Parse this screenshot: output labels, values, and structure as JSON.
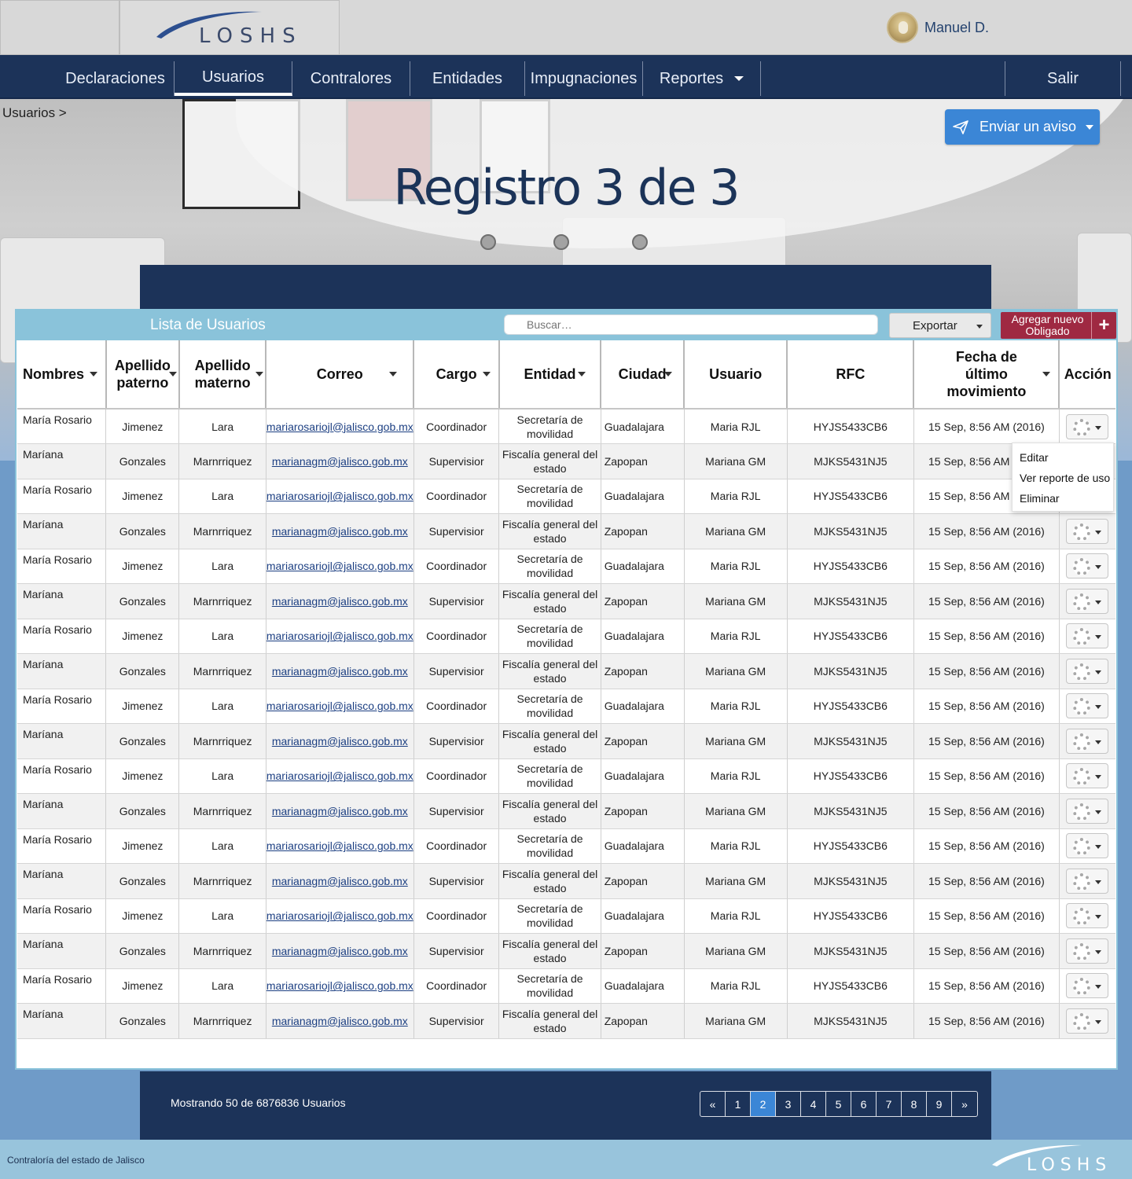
{
  "header": {
    "logo_text": "LOSHS",
    "user_name": "Manuel D."
  },
  "nav": {
    "items": [
      {
        "label": "Declaraciones"
      },
      {
        "label": "Usuarios"
      },
      {
        "label": "Contralores"
      },
      {
        "label": "Entidades"
      },
      {
        "label": "Impugnaciones"
      },
      {
        "label": "Reportes"
      }
    ],
    "active": "Usuarios",
    "logout": "Salir"
  },
  "hero": {
    "breadcrumb": "Usuarios >",
    "send_notice": "Enviar un aviso",
    "title": "Registro 3 de 3"
  },
  "panel": {
    "title": "Lista de Usuarios",
    "search_placeholder": "Buscar…",
    "export": "Exportar",
    "add_new": "Agregar nuevo Obligado",
    "add_icon": "+"
  },
  "table": {
    "headers": {
      "nombres": "Nombres",
      "ap_paterno": "Apellido paterno",
      "ap_materno": "Apellido materno",
      "correo": "Correo",
      "cargo": "Cargo",
      "entidad": "Entidad",
      "ciudad": "Ciudad",
      "usuario": "Usuario",
      "rfc": "RFC",
      "fecha": "Fecha de último movimiento",
      "accion": "Acción"
    },
    "rows": [
      {
        "nombres": "María Rosario",
        "paterno": "Jimenez",
        "materno": "Lara",
        "correo": "mariarosariojl@jalisco.gob.mx",
        "cargo": "Coordinador",
        "entidad": "Secretaría de movilidad",
        "ciudad": "Guadalajara",
        "usuario": "Maria RJL",
        "rfc": "HYJS5433CB6",
        "fecha": "15 Sep, 8:56 AM (2016)"
      },
      {
        "nombres": "Maríana",
        "paterno": "Gonzales",
        "materno": "Marnrriquez",
        "correo": "marianagm@jalisco.gob.mx",
        "cargo": "Supervisior",
        "entidad": "Fiscalía general del estado",
        "ciudad": "Zapopan",
        "usuario": "Mariana GM",
        "rfc": "MJKS5431NJ5",
        "fecha": "15 Sep, 8:56 AM (2016)"
      },
      {
        "nombres": "María Rosario",
        "paterno": "Jimenez",
        "materno": "Lara",
        "correo": "mariarosariojl@jalisco.gob.mx",
        "cargo": "Coordinador",
        "entidad": "Secretaría de movilidad",
        "ciudad": "Guadalajara",
        "usuario": "Maria RJL",
        "rfc": "HYJS5433CB6",
        "fecha": "15 Sep, 8:56 AM (2016)"
      },
      {
        "nombres": "Maríana",
        "paterno": "Gonzales",
        "materno": "Marnrriquez",
        "correo": "marianagm@jalisco.gob.mx",
        "cargo": "Supervisior",
        "entidad": "Fiscalía general del estado",
        "ciudad": "Zapopan",
        "usuario": "Mariana GM",
        "rfc": "MJKS5431NJ5",
        "fecha": "15 Sep, 8:56 AM (2016)"
      },
      {
        "nombres": "María Rosario",
        "paterno": "Jimenez",
        "materno": "Lara",
        "correo": "mariarosariojl@jalisco.gob.mx",
        "cargo": "Coordinador",
        "entidad": "Secretaría de movilidad",
        "ciudad": "Guadalajara",
        "usuario": "Maria RJL",
        "rfc": "HYJS5433CB6",
        "fecha": "15 Sep, 8:56 AM (2016)"
      },
      {
        "nombres": "Maríana",
        "paterno": "Gonzales",
        "materno": "Marnrriquez",
        "correo": "marianagm@jalisco.gob.mx",
        "cargo": "Supervisior",
        "entidad": "Fiscalía general del estado",
        "ciudad": "Zapopan",
        "usuario": "Mariana GM",
        "rfc": "MJKS5431NJ5",
        "fecha": "15 Sep, 8:56 AM (2016)"
      },
      {
        "nombres": "María Rosario",
        "paterno": "Jimenez",
        "materno": "Lara",
        "correo": "mariarosariojl@jalisco.gob.mx",
        "cargo": "Coordinador",
        "entidad": "Secretaría de movilidad",
        "ciudad": "Guadalajara",
        "usuario": "Maria RJL",
        "rfc": "HYJS5433CB6",
        "fecha": "15 Sep, 8:56 AM (2016)"
      },
      {
        "nombres": "Maríana",
        "paterno": "Gonzales",
        "materno": "Marnrriquez",
        "correo": "marianagm@jalisco.gob.mx",
        "cargo": "Supervisior",
        "entidad": "Fiscalía general del estado",
        "ciudad": "Zapopan",
        "usuario": "Mariana GM",
        "rfc": "MJKS5431NJ5",
        "fecha": "15 Sep, 8:56 AM (2016)"
      },
      {
        "nombres": "María Rosario",
        "paterno": "Jimenez",
        "materno": "Lara",
        "correo": "mariarosariojl@jalisco.gob.mx",
        "cargo": "Coordinador",
        "entidad": "Secretaría de movilidad",
        "ciudad": "Guadalajara",
        "usuario": "Maria RJL",
        "rfc": "HYJS5433CB6",
        "fecha": "15 Sep, 8:56 AM (2016)"
      },
      {
        "nombres": "Maríana",
        "paterno": "Gonzales",
        "materno": "Marnrriquez",
        "correo": "marianagm@jalisco.gob.mx",
        "cargo": "Supervisior",
        "entidad": "Fiscalía general del estado",
        "ciudad": "Zapopan",
        "usuario": "Mariana GM",
        "rfc": "MJKS5431NJ5",
        "fecha": "15 Sep, 8:56 AM (2016)"
      },
      {
        "nombres": "María Rosario",
        "paterno": "Jimenez",
        "materno": "Lara",
        "correo": "mariarosariojl@jalisco.gob.mx",
        "cargo": "Coordinador",
        "entidad": "Secretaría de movilidad",
        "ciudad": "Guadalajara",
        "usuario": "Maria RJL",
        "rfc": "HYJS5433CB6",
        "fecha": "15 Sep, 8:56 AM (2016)"
      },
      {
        "nombres": "Maríana",
        "paterno": "Gonzales",
        "materno": "Marnrriquez",
        "correo": "marianagm@jalisco.gob.mx",
        "cargo": "Supervisior",
        "entidad": "Fiscalía general del estado",
        "ciudad": "Zapopan",
        "usuario": "Mariana GM",
        "rfc": "MJKS5431NJ5",
        "fecha": "15 Sep, 8:56 AM (2016)"
      },
      {
        "nombres": "María Rosario",
        "paterno": "Jimenez",
        "materno": "Lara",
        "correo": "mariarosariojl@jalisco.gob.mx",
        "cargo": "Coordinador",
        "entidad": "Secretaría de movilidad",
        "ciudad": "Guadalajara",
        "usuario": "Maria RJL",
        "rfc": "HYJS5433CB6",
        "fecha": "15 Sep, 8:56 AM (2016)"
      },
      {
        "nombres": "Maríana",
        "paterno": "Gonzales",
        "materno": "Marnrriquez",
        "correo": "marianagm@jalisco.gob.mx",
        "cargo": "Supervisior",
        "entidad": "Fiscalía general del estado",
        "ciudad": "Zapopan",
        "usuario": "Mariana GM",
        "rfc": "MJKS5431NJ5",
        "fecha": "15 Sep, 8:56 AM (2016)"
      },
      {
        "nombres": "María Rosario",
        "paterno": "Jimenez",
        "materno": "Lara",
        "correo": "mariarosariojl@jalisco.gob.mx",
        "cargo": "Coordinador",
        "entidad": "Secretaría de movilidad",
        "ciudad": "Guadalajara",
        "usuario": "Maria RJL",
        "rfc": "HYJS5433CB6",
        "fecha": "15 Sep, 8:56 AM (2016)"
      },
      {
        "nombres": "Maríana",
        "paterno": "Gonzales",
        "materno": "Marnrriquez",
        "correo": "marianagm@jalisco.gob.mx",
        "cargo": "Supervisior",
        "entidad": "Fiscalía general del estado",
        "ciudad": "Zapopan",
        "usuario": "Mariana GM",
        "rfc": "MJKS5431NJ5",
        "fecha": "15 Sep, 8:56 AM (2016)"
      },
      {
        "nombres": "María Rosario",
        "paterno": "Jimenez",
        "materno": "Lara",
        "correo": "mariarosariojl@jalisco.gob.mx",
        "cargo": "Coordinador",
        "entidad": "Secretaría de movilidad",
        "ciudad": "Guadalajara",
        "usuario": "Maria RJL",
        "rfc": "HYJS5433CB6",
        "fecha": "15 Sep, 8:56 AM (2016)"
      },
      {
        "nombres": "Maríana",
        "paterno": "Gonzales",
        "materno": "Marnrriquez",
        "correo": "marianagm@jalisco.gob.mx",
        "cargo": "Supervisior",
        "entidad": "Fiscalía general del estado",
        "ciudad": "Zapopan",
        "usuario": "Mariana GM",
        "rfc": "MJKS5431NJ5",
        "fecha": "15 Sep, 8:56 AM (2016)"
      }
    ]
  },
  "row_menu": {
    "items": [
      "Editar",
      "Ver reporte de uso",
      "Eliminar"
    ]
  },
  "pagination": {
    "summary": "Mostrando 50 de 6876836 Usuarios",
    "pages": [
      "«",
      "1",
      "2",
      "3",
      "4",
      "5",
      "6",
      "7",
      "8",
      "9",
      "»"
    ],
    "current": "2"
  },
  "footer": {
    "org": "Contraloría del estado de Jalisco",
    "logo_text": "LOSHS"
  },
  "colors": {
    "navy": "#1c3359",
    "accent_blue": "#3b86d6",
    "panel_header": "#8ac3da",
    "add_button": "#9f2942"
  }
}
